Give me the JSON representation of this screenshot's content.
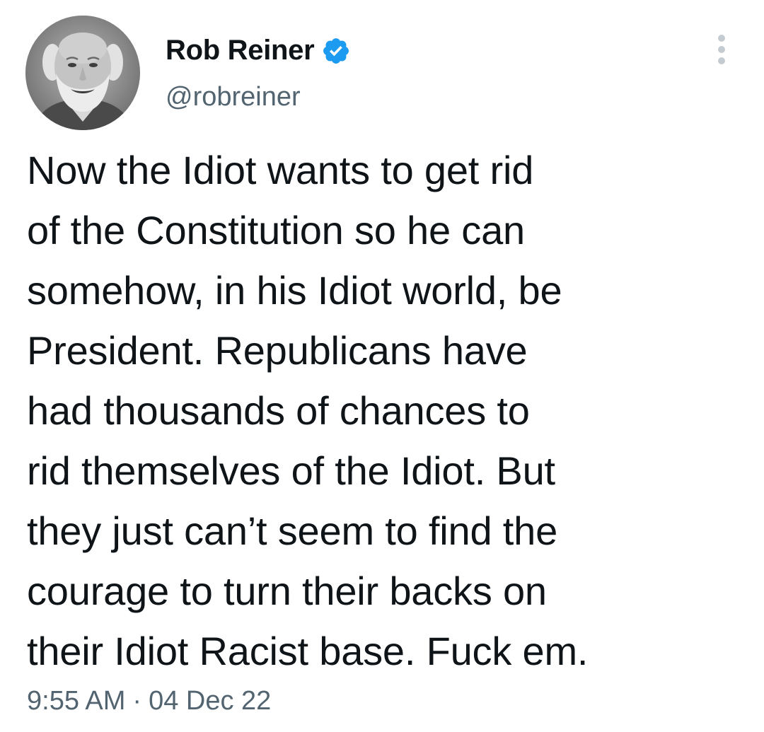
{
  "author": {
    "name": "Rob Reiner",
    "handle": "@robreiner",
    "verified": true
  },
  "tweet": {
    "lines": [
      "Now the Idiot wants to get rid",
      "of the Constitution so he can",
      "somehow, in his Idiot world, be",
      "President. Republicans have",
      "had thousands of chances to",
      "rid themselves of the Idiot. But",
      "they just can’t seem to find the",
      "courage to turn their backs on",
      "their Idiot Racist base. Fuck em."
    ],
    "time": "9:55 AM",
    "separator": "·",
    "date": "04 Dec 22"
  },
  "icons": {
    "verified": "verified-badge-icon",
    "more": "more-vertical-icon"
  },
  "colors": {
    "text": "#0f1419",
    "secondary": "#536471",
    "verified": "#1d9bf0",
    "background": "#ffffff"
  }
}
